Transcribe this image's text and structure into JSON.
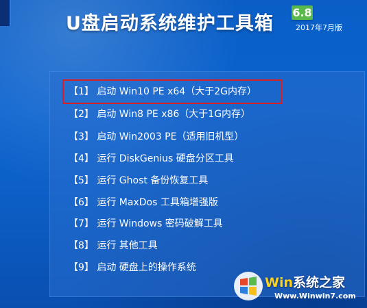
{
  "header": {
    "title": "U盘启动系统维护工具箱",
    "version": "6.8",
    "date": "2017年7月版"
  },
  "menu": {
    "items": [
      {
        "text": "【1】 启动 Win10 PE x64（大于2G内存）",
        "selected": true
      },
      {
        "text": "【2】 启动 Win8 PE x86（大于1G内存）"
      },
      {
        "text": "【3】 启动 Win2003 PE（适用旧机型）"
      },
      {
        "text": "【4】 运行 DiskGenius 硬盘分区工具"
      },
      {
        "text": "【5】 运行 Ghost 备份恢复工具"
      },
      {
        "text": "【6】 运行 MaxDos 工具箱增强版"
      },
      {
        "text": "【7】 运行 Windows 密码破解工具"
      },
      {
        "text": "【8】 运行 其他工具"
      },
      {
        "text": "【9】 启动 硬盘上的操作系统"
      }
    ],
    "selection_color": "#d81f26"
  },
  "watermark": {
    "brand_prefix": "Win",
    "brand_suffix": "系统之家",
    "url": "Www.Winwin7.com"
  },
  "colors": {
    "background": "#0b63cf",
    "badge": "#59b94d",
    "text": "#ffffff"
  }
}
